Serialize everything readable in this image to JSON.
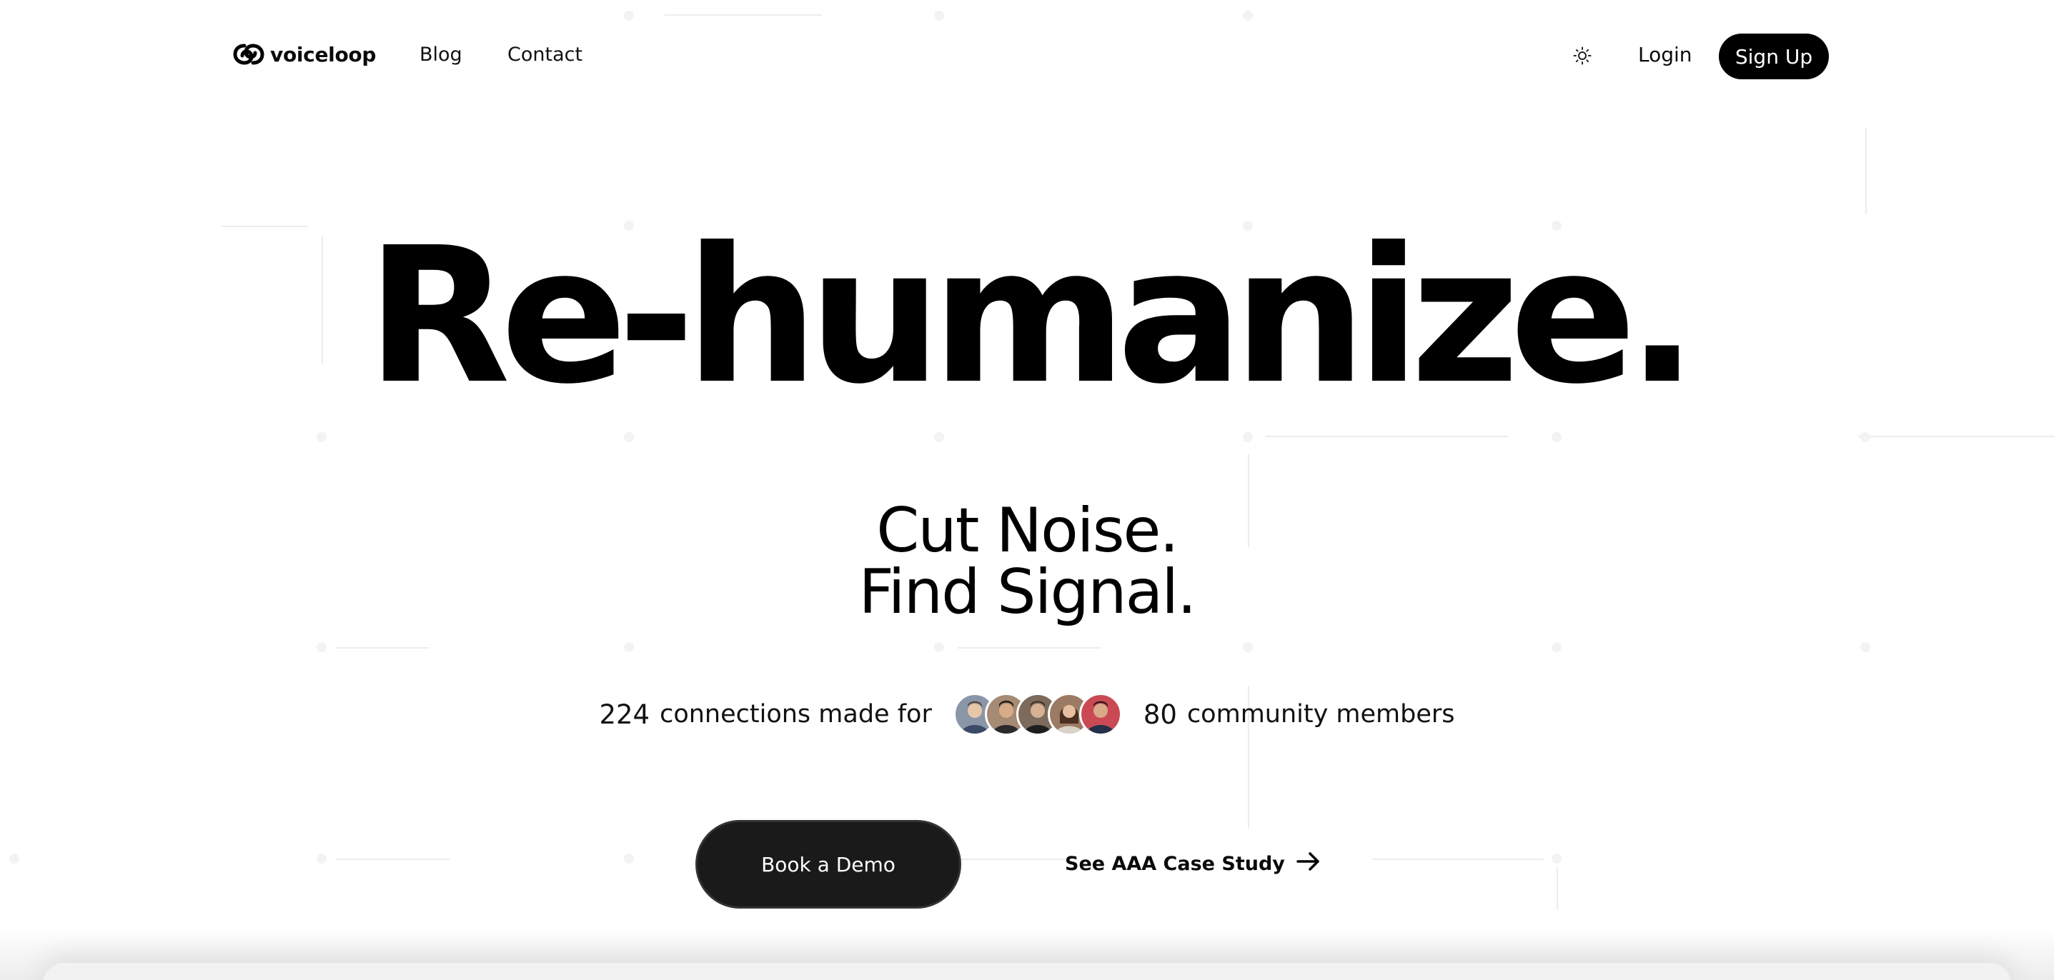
{
  "brand": {
    "name": "voiceloop",
    "logo_icon": "voiceloop-logo-icon"
  },
  "nav": {
    "links": [
      {
        "label": "Blog"
      },
      {
        "label": "Contact"
      }
    ],
    "theme_toggle_icon": "sun-icon",
    "login_label": "Login",
    "signup_label": "Sign Up"
  },
  "hero": {
    "headline": "Re-humanize.",
    "subhead_line1": "Cut Noise.",
    "subhead_line2": "Find Signal.",
    "stats": {
      "connections_count": "224",
      "connections_text": "connections made for",
      "members_count": "80",
      "members_text": "community members",
      "avatars": [
        {
          "icon": "person-avatar-1",
          "color": "#8a96a8"
        },
        {
          "icon": "person-avatar-2",
          "color": "#a58a74"
        },
        {
          "icon": "person-avatar-3",
          "color": "#7c6a5c"
        },
        {
          "icon": "person-avatar-4",
          "color": "#9c7a63"
        },
        {
          "icon": "person-avatar-5",
          "color": "#c94a55"
        }
      ]
    },
    "primary_cta": "Book a Demo",
    "secondary_cta": "See AAA Case Study",
    "secondary_cta_icon": "arrow-right-icon"
  },
  "colors": {
    "primary": "#000000",
    "button_dark": "#1a1a1a",
    "background": "#ffffff",
    "text": "#0a0a0a"
  }
}
